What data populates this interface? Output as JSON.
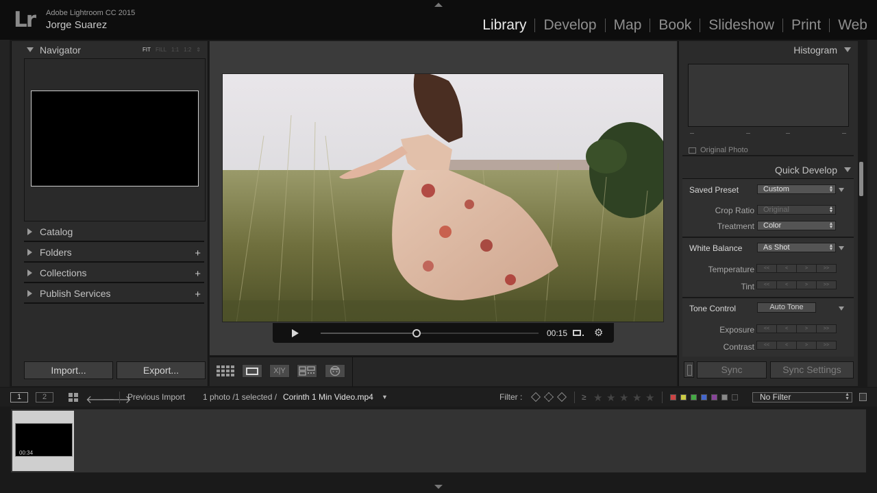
{
  "app": {
    "logo": "Lr",
    "name": "Adobe Lightroom CC 2015",
    "user": "Jorge Suarez"
  },
  "modules": [
    "Library",
    "Develop",
    "Map",
    "Book",
    "Slideshow",
    "Print",
    "Web"
  ],
  "active_module": "Library",
  "left_panel": {
    "navigator": {
      "title": "Navigator",
      "zoom_options": [
        "FIT",
        "FILL",
        "1:1",
        "1:2"
      ],
      "active_zoom": "FIT"
    },
    "sections": [
      {
        "label": "Catalog",
        "has_add": false
      },
      {
        "label": "Folders",
        "has_add": true
      },
      {
        "label": "Collections",
        "has_add": true
      },
      {
        "label": "Publish Services",
        "has_add": true
      }
    ],
    "import_label": "Import...",
    "export_label": "Export..."
  },
  "viewer": {
    "video_time": "00:15",
    "video_progress": 0.44
  },
  "toolbar": {
    "compare_label": "X|Y"
  },
  "right_panel": {
    "histogram_title": "Histogram",
    "original_photo_label": "Original Photo",
    "quick_develop_title": "Quick Develop",
    "saved_preset_label": "Saved Preset",
    "saved_preset_value": "Custom",
    "crop_ratio_label": "Crop Ratio",
    "crop_ratio_value": "Original",
    "treatment_label": "Treatment",
    "treatment_value": "Color",
    "white_balance_label": "White Balance",
    "white_balance_value": "As Shot",
    "temperature_label": "Temperature",
    "tint_label": "Tint",
    "tone_control_label": "Tone Control",
    "auto_tone_label": "Auto Tone",
    "exposure_label": "Exposure",
    "contrast_label": "Contrast",
    "step_glyphs": [
      "<<",
      "<",
      ">",
      ">>"
    ],
    "sync_label": "Sync",
    "sync_settings_label": "Sync Settings"
  },
  "filmstrip_bar": {
    "monitor_1": "1",
    "monitor_2": "2",
    "source": "Previous Import",
    "count": "1 photo /1 selected /",
    "file_name": "Corinth 1 Min Video.mp4",
    "filter_label": "Filter :",
    "rating_op": "≥",
    "filter_value": "No Filter",
    "color_labels": [
      "#c44",
      "#cc4",
      "#4a4",
      "#46c",
      "#849",
      "#888",
      "#222"
    ]
  },
  "filmstrip": {
    "thumb_duration": "00:34"
  }
}
